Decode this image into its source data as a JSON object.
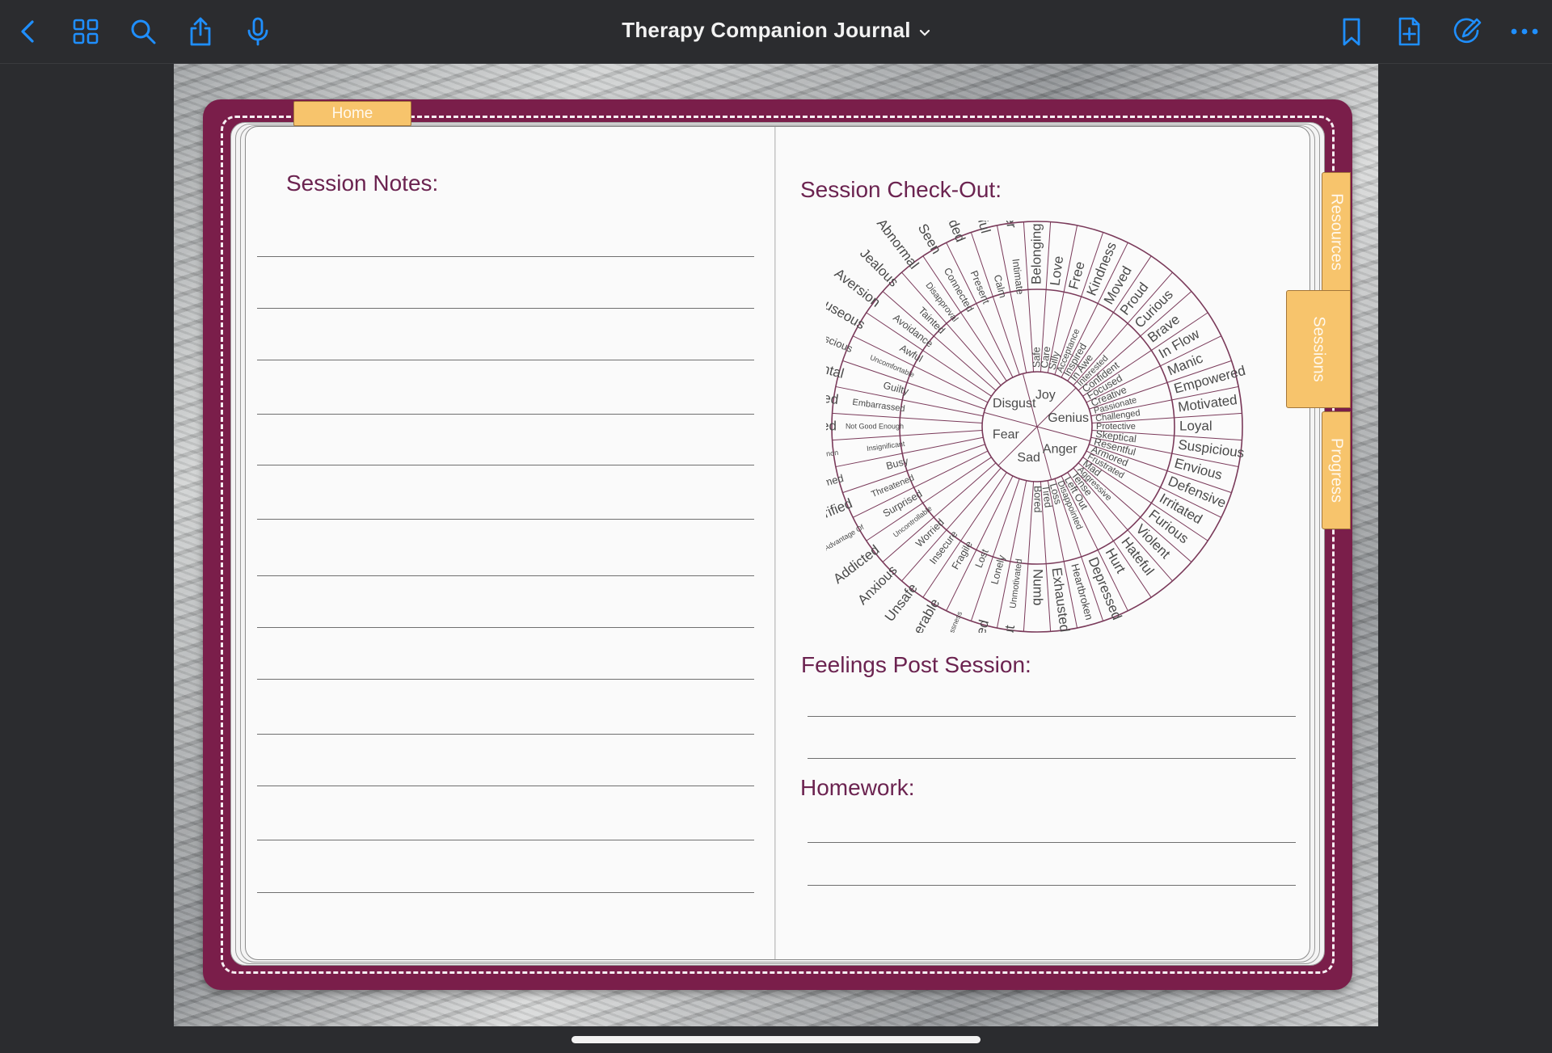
{
  "toolbar": {
    "title": "Therapy Companion Journal",
    "accent": "#1f8fff",
    "icons": [
      "back-chevron-icon",
      "grid-icon",
      "search-icon",
      "share-icon",
      "microphone-icon",
      "bookmark-icon",
      "add-page-icon",
      "pencil-circle-icon",
      "more-icon"
    ]
  },
  "tabs": {
    "home": "Home",
    "resources": "Resources",
    "sessions": "Sessions",
    "progress": "Progress"
  },
  "left_page": {
    "heading": "Session Notes:"
  },
  "right_page": {
    "checkout_heading": "Session Check-Out:",
    "feelings_heading": "Feelings Post Session:",
    "homework_heading": "Homework:"
  },
  "colors": {
    "cover": "#7a1e4a",
    "tab": "#f7c46c",
    "heading": "#6b2350",
    "wheel_stroke": "#7a3a5a"
  },
  "wheel": {
    "core": [
      "Joy",
      "Genius",
      "Anger",
      "Sad",
      "Fear",
      "Disgust"
    ],
    "middle": [
      "Safe",
      "Care",
      "Silly",
      "Acceptance",
      "Inspired",
      "In Awe",
      "Interested",
      "Confident",
      "Focused",
      "Creative",
      "Passionate",
      "Challenged",
      "Protective",
      "Skeptical",
      "Resentful",
      "Armored",
      "Frustrated",
      "Mad",
      "Aggressive",
      "Tense",
      "Left Out",
      "Disappointed",
      "Loss",
      "Tired",
      "Bored",
      "Unmotivated",
      "Lonely",
      "Lost",
      "Fragile",
      "Insecure",
      "Worried",
      "Uncontrollable",
      "Surprised",
      "Threatened",
      "Busy",
      "Insignificant",
      "Not Good Enough",
      "Embarrassed",
      "Guilty",
      "Uncomfortable",
      "Awful",
      "Avoidance",
      "Tainted",
      "Disapproval",
      "Connected",
      "Present",
      "Calm",
      "Intimate"
    ],
    "outer": [
      "Belonging",
      "Love",
      "Free",
      "Kindness",
      "Moved",
      "Proud",
      "Curious",
      "Brave",
      "In Flow",
      "Manic",
      "Empowered",
      "Motivated",
      "Loyal",
      "Suspicious",
      "Envious",
      "Defensive",
      "Irritated",
      "Furious",
      "Violent",
      "Hateful",
      "Hurt",
      "Depressed",
      "Heartbroken",
      "Exhausted",
      "Numb",
      "Burned Out",
      "Isolated",
      "Purposelessness",
      "Vulnerable",
      "Unsafe",
      "Anxious",
      "Addicted",
      "Taken Advantage Of",
      "Terrified",
      "Overwhelmed",
      "Imposter Phenomenon",
      "Ashamed",
      "Humiliated",
      "Judgmental",
      "Self-conscious",
      "Nauseous",
      "Aversion",
      "Jealous",
      "Abnormal",
      "Seen",
      "Grounded",
      "Grateful",
      "Tender"
    ]
  }
}
